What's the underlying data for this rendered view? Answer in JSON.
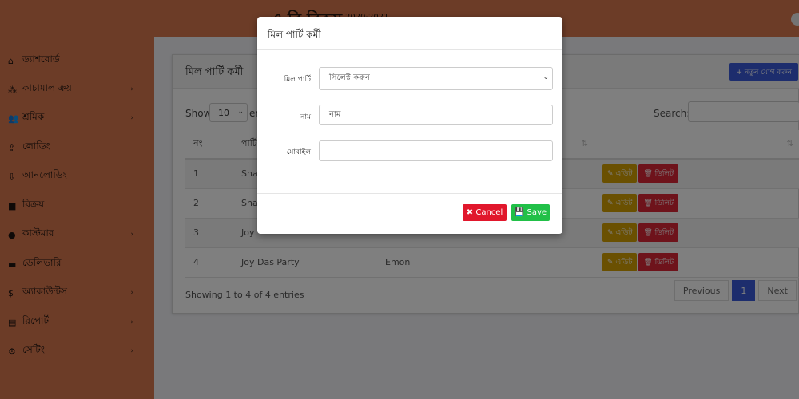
{
  "header": {
    "brand": "এ বি বিকস",
    "year": "2020-2021"
  },
  "sidebar": {
    "items": [
      {
        "label": "ড্যাশবোর্ড",
        "icon": "home-icon",
        "glyph": "⌂",
        "chevron": ""
      },
      {
        "label": "কাচামাল ক্রয়",
        "icon": "cubes-icon",
        "glyph": "⁂",
        "chevron": "›"
      },
      {
        "label": "শ্রমিক",
        "icon": "users-icon",
        "glyph": "👥",
        "chevron": "›"
      },
      {
        "label": "লোডিং",
        "icon": "loading-icon",
        "glyph": "⇪",
        "chevron": ""
      },
      {
        "label": "আনলোডিং",
        "icon": "truck-loading-icon",
        "glyph": "⇩",
        "chevron": ""
      },
      {
        "label": "বিক্রয়",
        "icon": "shopping-bag-icon",
        "glyph": "■",
        "chevron": ""
      },
      {
        "label": "কাস্টমার",
        "icon": "user-icon",
        "glyph": "●",
        "chevron": "›"
      },
      {
        "label": "ডেলিভারি",
        "icon": "truck-icon",
        "glyph": "▬",
        "chevron": ""
      },
      {
        "label": "অ্যাকাউন্টস",
        "icon": "hand-money-icon",
        "glyph": "$",
        "chevron": "›"
      },
      {
        "label": "রিপোর্ট",
        "icon": "clipboard-icon",
        "glyph": "▤",
        "chevron": "›"
      },
      {
        "label": "সেটিং",
        "icon": "gear-icon",
        "glyph": "⚙",
        "chevron": "›"
      }
    ]
  },
  "card": {
    "title": "মিল পার্টি কর্মী",
    "add_button": "+ নতুন যোগ করুন",
    "show_label": "Show",
    "show_value": "10",
    "entries_label": "en",
    "search_label": "Search:",
    "columns": [
      "নং",
      "পার্টি",
      "",
      "",
      ""
    ],
    "rows": [
      {
        "no": "1",
        "party": "Sha",
        "name": ""
      },
      {
        "no": "2",
        "party": "Sha",
        "name": ""
      },
      {
        "no": "3",
        "party": "Joy",
        "name": ""
      },
      {
        "no": "4",
        "party": "Joy Das Party",
        "name": "Emon"
      }
    ],
    "edit_label": "✎ এডিট",
    "delete_label": "🗑 ডিলিট",
    "showing": "Showing 1 to 4 of 4 entries",
    "pagination": {
      "previous": "Previous",
      "current": "1",
      "next": "Next"
    }
  },
  "modal": {
    "title": "মিল পার্টি কর্মী",
    "party_label": "মিল পার্টি",
    "party_value": "সিলেক্ট করুন",
    "name_label": "নাম",
    "name_placeholder": "নাম",
    "mobile_label": "মোবাইল",
    "mobile_value": "",
    "cancel": "✖ Cancel",
    "save": "💾 Save"
  },
  "colors": {
    "sidebar": "#d9794f",
    "primary": "#3b5bdb",
    "warning": "#d4a003",
    "danger": "#dc2637",
    "success": "#21c048"
  }
}
